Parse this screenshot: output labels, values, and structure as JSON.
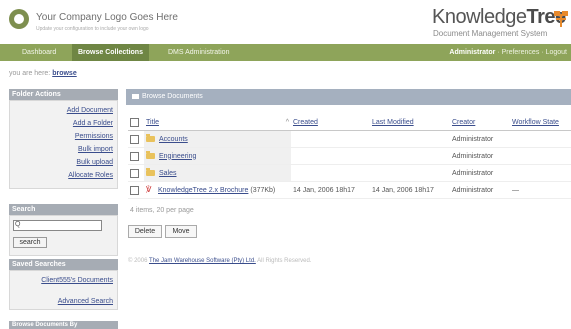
{
  "header": {
    "company_logo_title": "Your Company Logo Goes Here",
    "company_logo_subtitle": "Update your configuration to include your own logo",
    "product_name_light": "Knowledge",
    "product_name_bold": "Tree",
    "product_tagline": "Document Management System"
  },
  "nav": {
    "tabs": [
      "Dashboard",
      "Browse Collections",
      "DMS Administration"
    ],
    "active_tab": "Browse Collections",
    "user": "Administrator",
    "sep": "·",
    "preferences": "Preferences",
    "logout": "Logout"
  },
  "breadcrumb": {
    "prefix": "you are here:",
    "current": "browse"
  },
  "sidebar": {
    "folder_actions_title": "Folder Actions",
    "folder_actions": [
      "Add Document",
      "Add a Folder",
      "Permissions",
      "Bulk import",
      "Bulk upload",
      "Allocate Roles"
    ],
    "search_title": "Search",
    "search_icon_label": "Q",
    "search_button": "search",
    "saved_searches_title": "Saved Searches",
    "saved_searches": [
      "Client555's Documents"
    ],
    "advanced_search": "Advanced Search",
    "browse_by_title": "Browse Documents By"
  },
  "main": {
    "panel_title": "Browse Documents",
    "columns": [
      "Title",
      "Created",
      "Last Modified",
      "Creator",
      "Workflow State"
    ],
    "sort_indicator": "^",
    "rows": [
      {
        "type": "folder",
        "title": "Accounts",
        "size": "",
        "created": "",
        "modified": "",
        "creator": "Administrator",
        "workflow": ""
      },
      {
        "type": "folder",
        "title": "Engineering",
        "size": "",
        "created": "",
        "modified": "",
        "creator": "Administrator",
        "workflow": ""
      },
      {
        "type": "folder",
        "title": "Sales",
        "size": "",
        "created": "",
        "modified": "",
        "creator": "Administrator",
        "workflow": ""
      },
      {
        "type": "pdf",
        "title": "KnowledgeTree 2.x Brochure",
        "size": "(377Kb)",
        "created": "14 Jan, 2006 18h17",
        "modified": "14 Jan, 2006 18h17",
        "creator": "Administrator",
        "workflow": "—"
      }
    ],
    "paging": "4 items, 20 per page",
    "delete_button": "Delete",
    "move_button": "Move"
  },
  "footer": {
    "prefix": "© 2006",
    "company": "The Jam Warehouse Software (Pty) Ltd.",
    "suffix": "All Rights Reserved."
  },
  "colors": {
    "nav_green": "#8ea45a",
    "nav_active": "#6f8644",
    "panel_head": "#a5b0bf",
    "link": "#3a4d8c"
  }
}
